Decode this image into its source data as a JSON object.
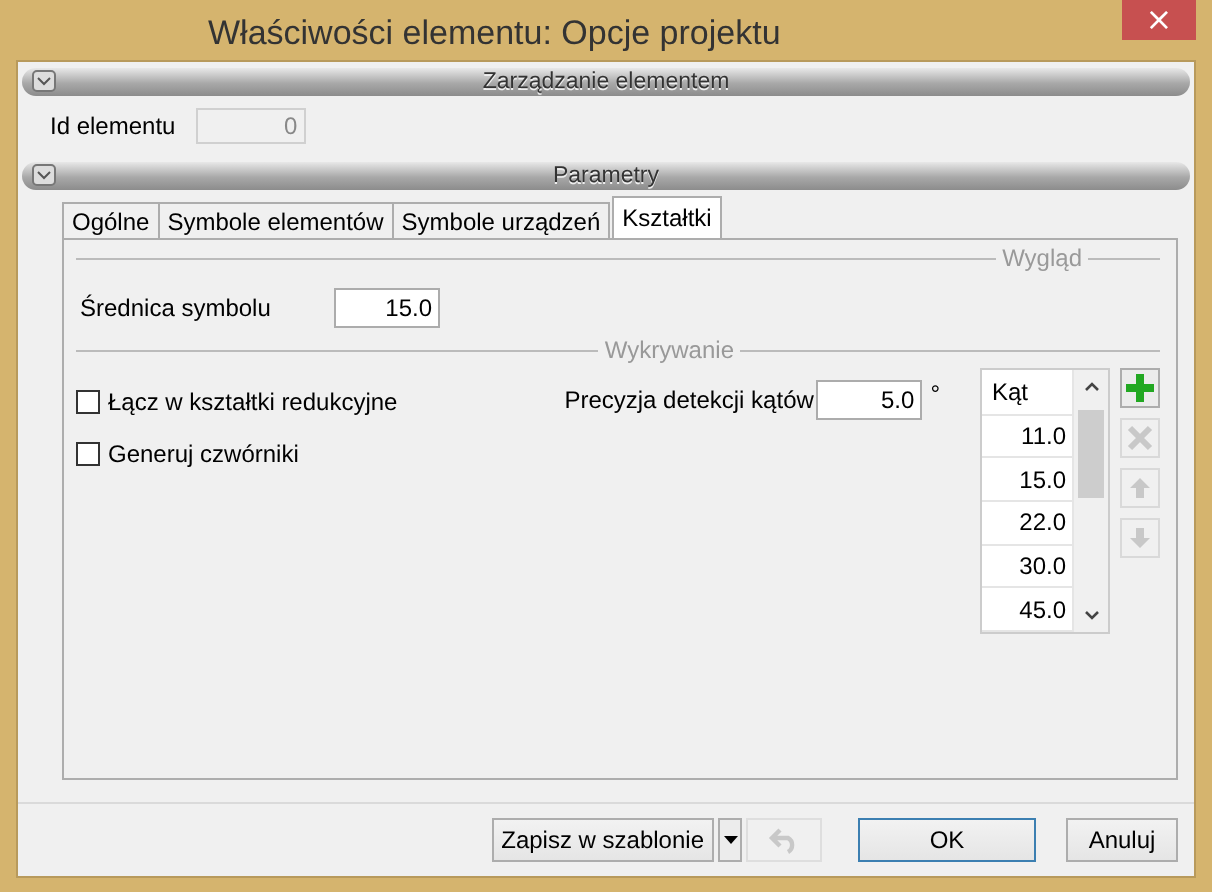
{
  "window": {
    "title": "Właściwości elementu: Opcje projektu",
    "close": "×"
  },
  "sections": [
    {
      "title": "Zarządzanie elementem",
      "expanded": true
    },
    {
      "title": "Parametry",
      "expanded": true
    }
  ],
  "id_field": {
    "label": "Id elementu",
    "value": "0",
    "disabled": true
  },
  "tabs": [
    {
      "label": "Ogólne",
      "selected": false
    },
    {
      "label": "Symbole elementów",
      "selected": false
    },
    {
      "label": "Symbole urządzeń",
      "selected": false
    },
    {
      "label": "Kształtki",
      "selected": true
    }
  ],
  "appearance": {
    "title": "Wygląd",
    "diameter": {
      "label": "Średnica symbolu",
      "value": "15.0"
    }
  },
  "detection": {
    "title": "Wykrywanie",
    "checkboxes": [
      {
        "label": "Łącz w kształtki redukcyjne",
        "checked": false
      },
      {
        "label": "Generuj czwórniki",
        "checked": false
      }
    ],
    "precision": {
      "label": "Precyzja detekcji kątów",
      "value": "5.0",
      "unit": "°"
    },
    "angle_table": {
      "column": "Kąt",
      "rows": [
        "11.0",
        "15.0",
        "22.0",
        "30.0",
        "45.0"
      ]
    },
    "list_buttons": [
      {
        "kind": "add",
        "disabled": false
      },
      {
        "kind": "delete",
        "disabled": true
      },
      {
        "kind": "up",
        "disabled": true
      },
      {
        "kind": "down",
        "disabled": true
      }
    ]
  },
  "footer": {
    "save_template": "Zapisz w szablonie",
    "undo_disabled": true,
    "ok": "OK",
    "cancel": "Anuluj"
  }
}
